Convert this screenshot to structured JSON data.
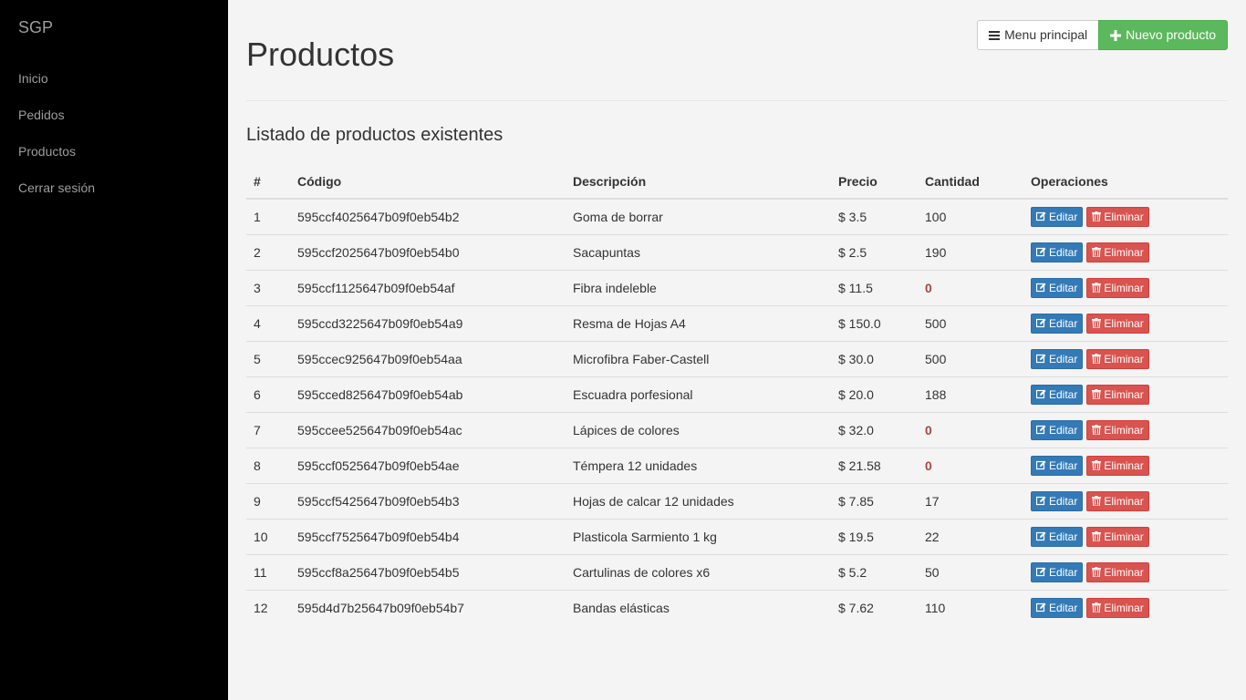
{
  "sidebar": {
    "brand": "SGP",
    "items": [
      {
        "label": "Inicio"
      },
      {
        "label": "Pedidos"
      },
      {
        "label": "Productos"
      },
      {
        "label": "Cerrar sesión"
      }
    ]
  },
  "header": {
    "title": "Productos",
    "menu_button": "Menu principal",
    "menu_icon": "bars-icon",
    "new_button": "Nuevo producto",
    "new_icon": "plus-icon"
  },
  "main": {
    "subtitle": "Listado de productos existentes"
  },
  "table": {
    "columns": [
      "#",
      "Código",
      "Descripción",
      "Precio",
      "Cantidad",
      "Operaciones"
    ],
    "edit_label": "Editar",
    "delete_label": "Eliminar",
    "edit_icon": "edit-icon",
    "delete_icon": "trash-icon",
    "rows": [
      {
        "num": "1",
        "code": "595ccf4025647b09f0eb54b2",
        "desc": "Goma de borrar",
        "price": "$ 3.5",
        "qty": "100"
      },
      {
        "num": "2",
        "code": "595ccf2025647b09f0eb54b0",
        "desc": "Sacapuntas",
        "price": "$ 2.5",
        "qty": "190"
      },
      {
        "num": "3",
        "code": "595ccf1125647b09f0eb54af",
        "desc": "Fibra indeleble",
        "price": "$ 11.5",
        "qty": "0"
      },
      {
        "num": "4",
        "code": "595ccd3225647b09f0eb54a9",
        "desc": "Resma de Hojas A4",
        "price": "$ 150.0",
        "qty": "500"
      },
      {
        "num": "5",
        "code": "595ccec925647b09f0eb54aa",
        "desc": "Microfibra Faber-Castell",
        "price": "$ 30.0",
        "qty": "500"
      },
      {
        "num": "6",
        "code": "595cced825647b09f0eb54ab",
        "desc": "Escuadra porfesional",
        "price": "$ 20.0",
        "qty": "188"
      },
      {
        "num": "7",
        "code": "595ccee525647b09f0eb54ac",
        "desc": "Lápices de colores",
        "price": "$ 32.0",
        "qty": "0"
      },
      {
        "num": "8",
        "code": "595ccf0525647b09f0eb54ae",
        "desc": "Témpera 12 unidades",
        "price": "$ 21.58",
        "qty": "0"
      },
      {
        "num": "9",
        "code": "595ccf5425647b09f0eb54b3",
        "desc": "Hojas de calcar 12 unidades",
        "price": "$ 7.85",
        "qty": "17"
      },
      {
        "num": "10",
        "code": "595ccf7525647b09f0eb54b4",
        "desc": "Plasticola Sarmiento 1 kg",
        "price": "$ 19.5",
        "qty": "22"
      },
      {
        "num": "11",
        "code": "595ccf8a25647b09f0eb54b5",
        "desc": "Cartulinas de colores x6",
        "price": "$ 5.2",
        "qty": "50"
      },
      {
        "num": "12",
        "code": "595d4d7b25647b09f0eb54b7",
        "desc": "Bandas elásticas",
        "price": "$ 7.62",
        "qty": "110"
      }
    ]
  },
  "colors": {
    "sidebar_bg": "#000000",
    "content_bg": "#f4f4f4",
    "primary": "#337ab7",
    "success": "#5cb85c",
    "danger": "#d9534f",
    "out_of_stock": "#a94442"
  }
}
